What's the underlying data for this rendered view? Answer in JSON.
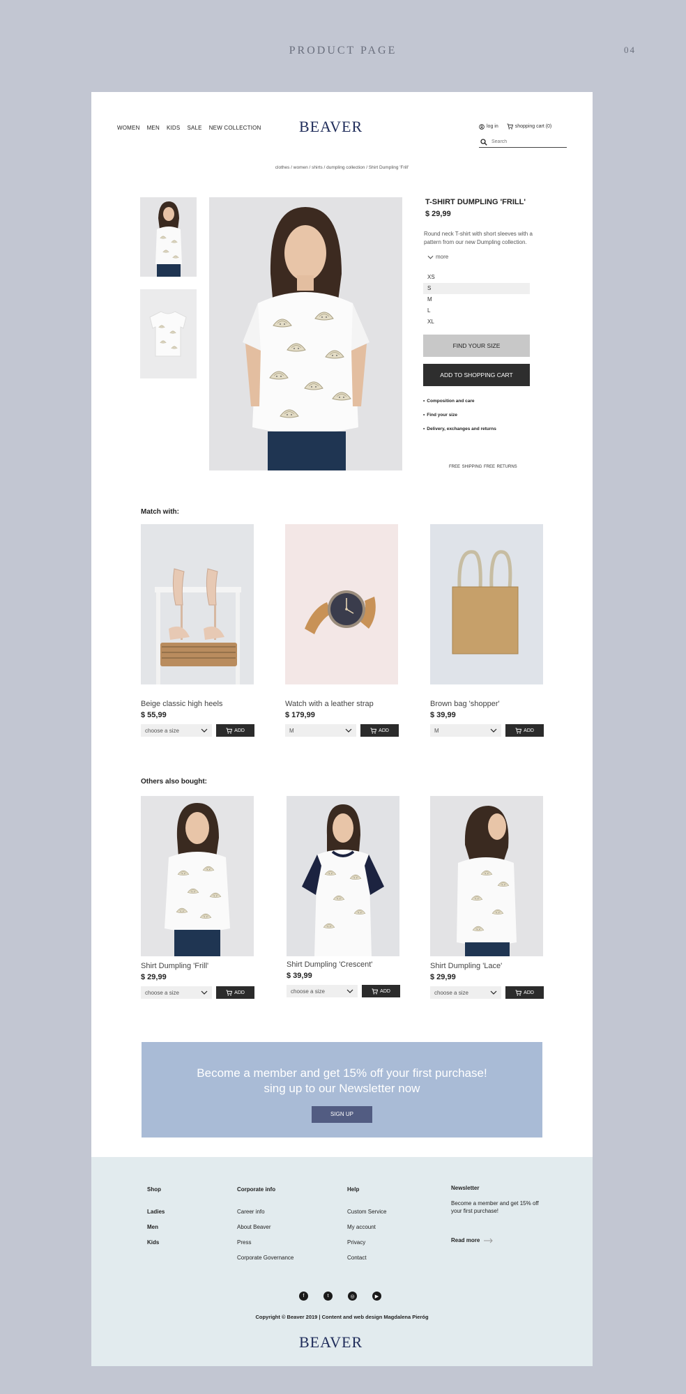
{
  "page_label": "PRODUCT PAGE",
  "page_number": "04",
  "header": {
    "nav": [
      "WOMEN",
      "MEN",
      "KIDS",
      "SALE",
      "NEW COLLECTION"
    ],
    "logo": "BEAVER",
    "login": "log in",
    "cart": "shopping cart (0)",
    "search_placeholder": "Search"
  },
  "breadcrumb": "clothes / women / shirts / dumpling collection / Shirt Dumpling 'Frill'",
  "product": {
    "title": "T-SHIRT DUMPLING 'FRILL'",
    "price": "$ 29,99",
    "description": "Round neck T-shirt with short sleeves with a pattern from our new Dumpling collection.",
    "more": "more",
    "sizes": [
      "XS",
      "S",
      "M",
      "L",
      "XL"
    ],
    "selected_size": "S",
    "find_size_button": "FIND YOUR SIZE",
    "add_to_cart_button": "ADD TO SHOPPING CART",
    "info_links": [
      "Composition and care",
      "Find your size",
      "Delivery, exchanges and returns"
    ],
    "shipping": "FREE SHIPPING   FREE RETURNS"
  },
  "match_with": {
    "title": "Match with:",
    "items": [
      {
        "name": "Beige classic high heels",
        "price": "$ 55,99",
        "size": "choose a size",
        "add": "ADD"
      },
      {
        "name": "Watch with a leather strap",
        "price": "$ 179,99",
        "size": "M",
        "add": "ADD"
      },
      {
        "name": "Brown bag 'shopper'",
        "price": "$ 39,99",
        "size": "M",
        "add": "ADD"
      }
    ]
  },
  "others": {
    "title": "Others also bought:",
    "items": [
      {
        "name": "Shirt Dumpling  'Frill'",
        "price": "$ 29,99",
        "size": "choose a size",
        "add": "ADD"
      },
      {
        "name": "Shirt Dumpling 'Crescent'",
        "price": "$ 39,99",
        "size": "choose a size",
        "add": "ADD"
      },
      {
        "name": "Shirt Dumpling 'Lace'",
        "price": "$ 29,99",
        "size": "choose a size",
        "add": "ADD"
      }
    ]
  },
  "promo": {
    "line1": "Become a member and  get 15% off  your first purchase!",
    "line2": "sing up to our Newsletter now",
    "button": "SIGN UP"
  },
  "footer": {
    "shop": {
      "title": "Shop",
      "links": [
        "Ladies",
        "Men",
        "Kids"
      ]
    },
    "corporate": {
      "title": "Corporate info",
      "links": [
        "Career info",
        "About Beaver",
        "Press",
        "Corporate Governance"
      ]
    },
    "help": {
      "title": "Help",
      "links": [
        "Custom Service",
        "My account",
        "Privacy",
        "Contact"
      ]
    },
    "newsletter": {
      "title": "Newsletter",
      "text": "Become a member and get 15% off your first purchase!",
      "read_more": "Read more"
    },
    "social": [
      "facebook-icon",
      "twitter-icon",
      "instagram-icon",
      "youtube-icon"
    ],
    "copyright": "Copyright © Beaver 2019 | Content and web design Magdalena Pieróg",
    "logo": "BEAVER"
  },
  "colors": {
    "page_bg": "#c2c6d2",
    "brand": "#1f2c5a",
    "promo_bg": "#a9bbd6",
    "promo_button": "#525c82",
    "footer_bg": "#e2ebee",
    "dark_button": "#2e2e2e"
  }
}
